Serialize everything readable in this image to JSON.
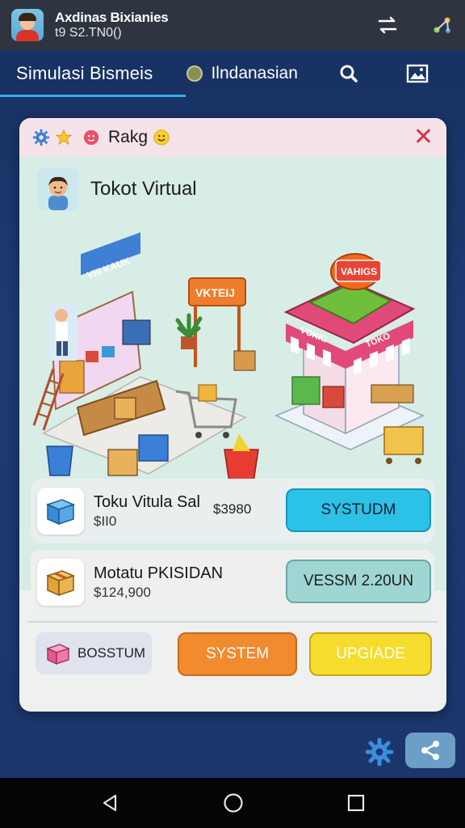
{
  "statusbar": {
    "title": "Axdinas Bixianies",
    "subtitle": "t9 S2.TN0()"
  },
  "tabs": {
    "main": "Simulasi Bismeis",
    "language": "Ilndanasian"
  },
  "card": {
    "header_title": "Rakg",
    "shop_name": "Tokot Virtual",
    "scene_signs": {
      "store_banner": "VIII KAUK",
      "arch_sign": "VKTEIJ",
      "roof_sign": "VAHIGS",
      "awning_left": "VOKKI",
      "awning_right": "TOKO"
    }
  },
  "items": [
    {
      "name": "Toku Vitula Sal",
      "price": "$II0",
      "extra_price": "$3980",
      "button": "SYSTUDM"
    },
    {
      "name": "Motatu PKISIDAN",
      "price": "$124,900",
      "button": "VESSM 2.20UN"
    }
  ],
  "bottom": {
    "tag_label": "BOSSTUM",
    "system_button": "SYSTEM",
    "upgrade_button": "UPGIADE"
  },
  "colors": {
    "accent": "#3aa7ef",
    "close": "#d7334a",
    "btn_cyan": "#2cc1e6",
    "btn_teal": "#9fd6d4",
    "btn_orange": "#f28a2e",
    "btn_yellow": "#f6dd2d"
  }
}
